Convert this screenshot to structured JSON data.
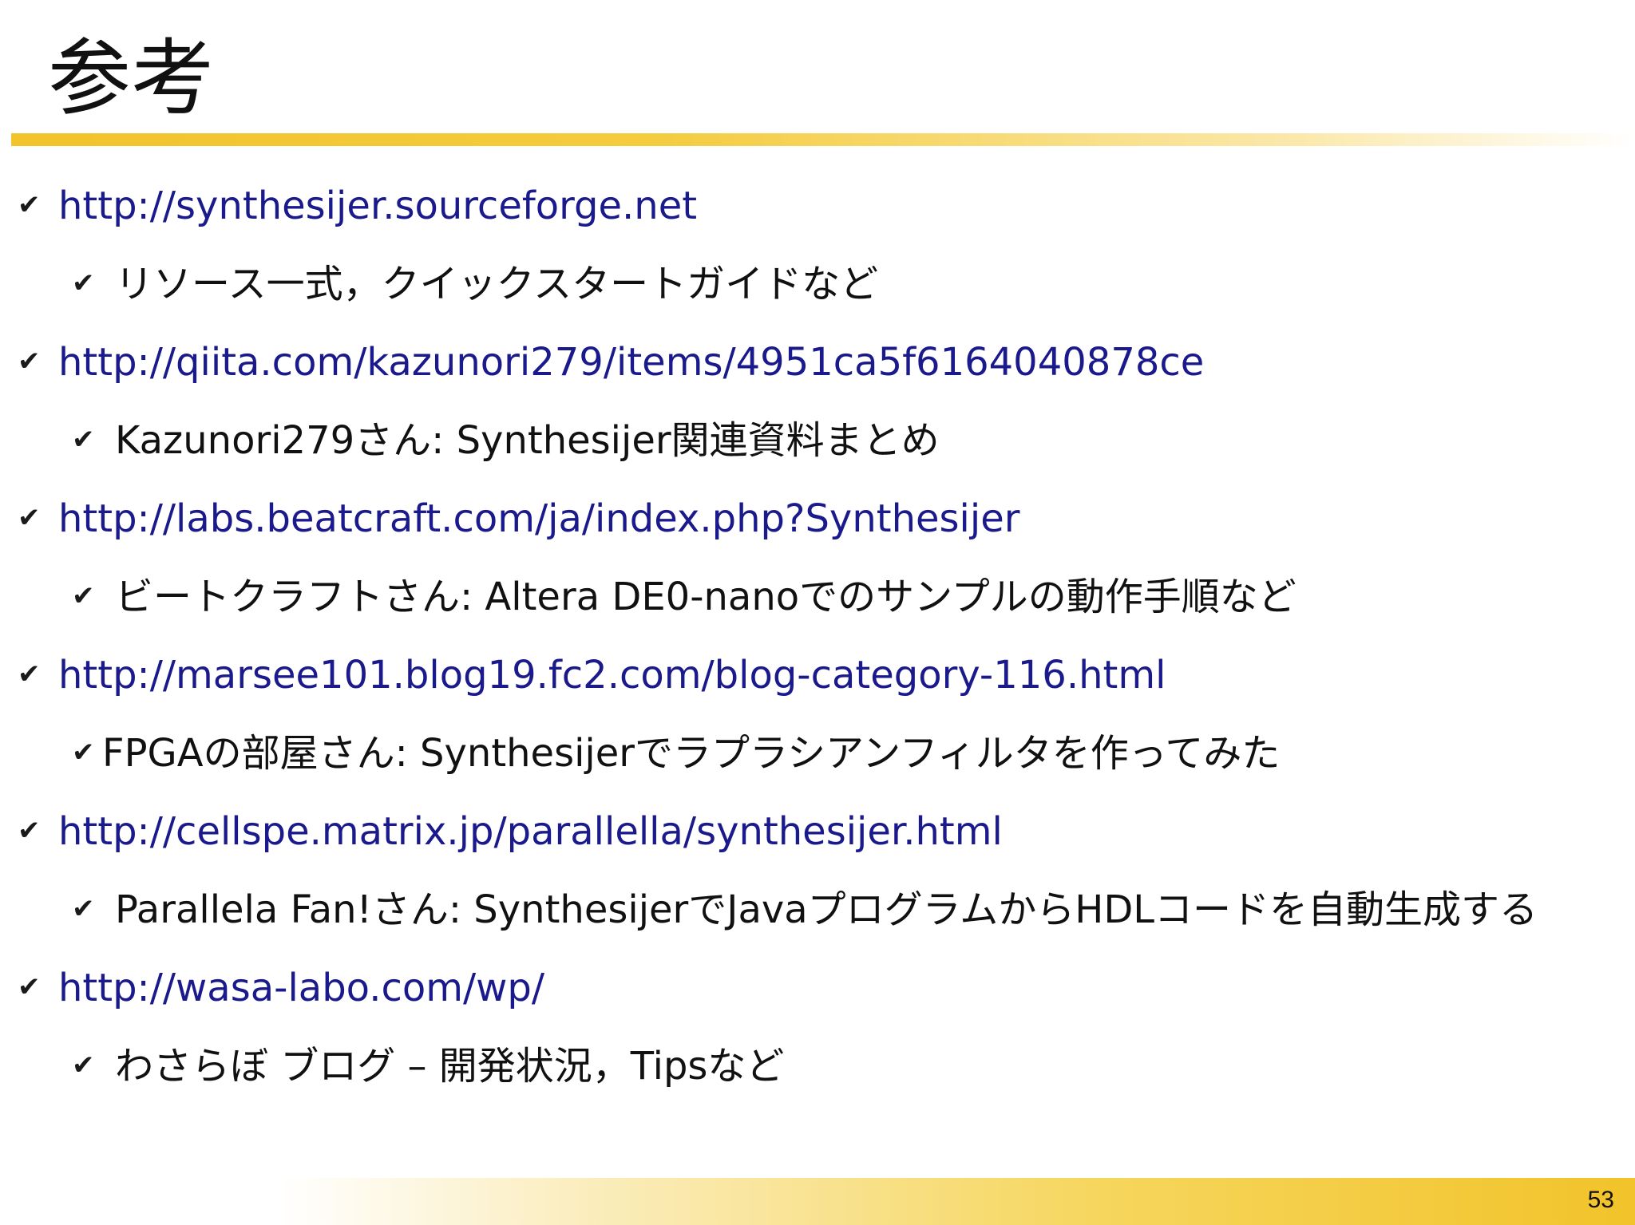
{
  "slide": {
    "title": "参考",
    "page_number": "53",
    "check_glyph": "✔",
    "link_color": "#1a1a8c",
    "accent_color": "#f2c32a"
  },
  "references": [
    {
      "url": "http://synthesijer.sourceforge.net",
      "note": "リソース一式，クイックスタートガイドなど"
    },
    {
      "url": "http://qiita.com/kazunori279/items/4951ca5f6164040878ce",
      "note": "Kazunori279さん: Synthesijer関連資料まとめ"
    },
    {
      "url": "http://labs.beatcraft.com/ja/index.php?Synthesijer",
      "note": "ビートクラフトさん: Altera DE0-nanoでのサンプルの動作手順など"
    },
    {
      "url": "http://marsee101.blog19.fc2.com/blog-category-116.html",
      "note": "FPGAの部屋さん: Synthesijerでラプラシアンフィルタを作ってみた"
    },
    {
      "url": "http://cellspe.matrix.jp/parallella/synthesijer.html",
      "note": "Parallela Fan!さん: SynthesijerでJavaプログラムからHDLコードを自動生成する"
    },
    {
      "url": "http://wasa-labo.com/wp/",
      "note": "わさらぼ ブログ – 開発状況，Tipsなど"
    }
  ]
}
